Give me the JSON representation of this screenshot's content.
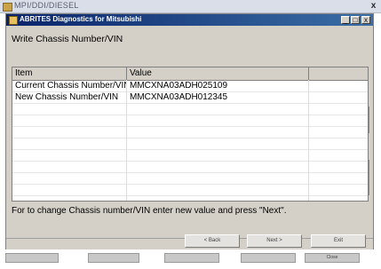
{
  "outer_window": {
    "title": "MPI/DDI/DIESEL",
    "close_glyph": "x"
  },
  "window": {
    "title": "ABRITES Diagnostics for Mitsubishi",
    "caption_buttons": {
      "minimize": "_",
      "maximize": "□",
      "close": "x"
    }
  },
  "page": {
    "heading": "Write Chassis Number/VIN",
    "hint": "For to change Chassis number/VIN enter new value and press \"Next\"."
  },
  "grid": {
    "columns": [
      "Item",
      "Value",
      ""
    ],
    "rows": [
      {
        "item": "Current Chassis Number/VIN",
        "value": "MMCXNA03ADH025109"
      },
      {
        "item": "New Chassis Number/VIN",
        "value": "MMCXNA03ADH012345"
      }
    ]
  },
  "buttons": {
    "back": "< Back",
    "next": "Next >",
    "exit": "Exit"
  },
  "taskbar": {
    "tabs": [
      "",
      "",
      "",
      "",
      "Close"
    ]
  }
}
